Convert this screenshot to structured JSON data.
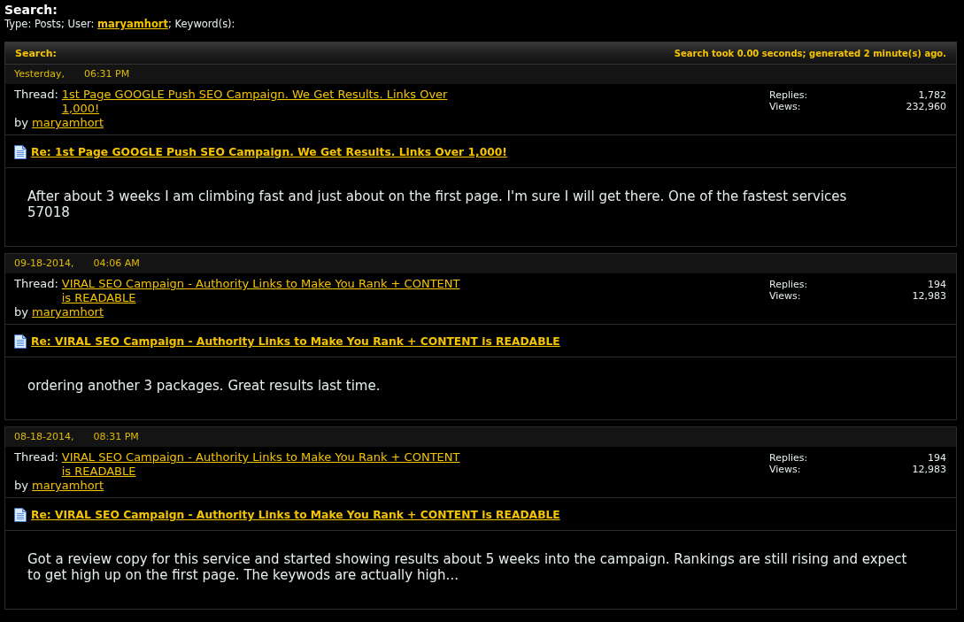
{
  "page_title": "Search:",
  "search_criteria": {
    "before_user": "Type: Posts; User:",
    "user": "maryamhort",
    "after_user": "; Keyword(s):"
  },
  "results_header": {
    "title": "Search:",
    "stats": "Search took 0.00 seconds; generated 2 minute(s) ago."
  },
  "posts": [
    {
      "date": "Yesterday,",
      "time": "06:31 PM",
      "thread_label": "Thread:",
      "thread_title": "1st Page GOOGLE Push SEO Campaign. We Get Results. Links Over 1,000!",
      "by_label": "by",
      "author": "maryamhort",
      "replies_label": "Replies:",
      "replies": "1,782",
      "views_label": "Views:",
      "views": "232,960",
      "post_title": "Re: 1st Page GOOGLE Push SEO Campaign. We Get Results. Links Over 1,000!",
      "excerpt": "After about 3 weeks I am climbing fast and just about on the first page. I'm sure I will get there. One of the fastest services\n57018"
    },
    {
      "date": "09-18-2014,",
      "time": "04:06 AM",
      "thread_label": "Thread:",
      "thread_title": "VIRAL SEO Campaign - Authority Links to Make You Rank + CONTENT is READABLE",
      "by_label": "by",
      "author": "maryamhort",
      "replies_label": "Replies:",
      "replies": "194",
      "views_label": "Views:",
      "views": "12,983",
      "post_title": "Re: VIRAL SEO Campaign - Authority Links to Make You Rank + CONTENT is READABLE",
      "excerpt": "ordering another 3 packages. Great results last time."
    },
    {
      "date": "08-18-2014,",
      "time": "08:31 PM",
      "thread_label": "Thread:",
      "thread_title": "VIRAL SEO Campaign - Authority Links to Make You Rank + CONTENT is READABLE",
      "by_label": "by",
      "author": "maryamhort",
      "replies_label": "Replies:",
      "replies": "194",
      "views_label": "Views:",
      "views": "12,983",
      "post_title": "Re: VIRAL SEO Campaign - Authority Links to Make You Rank + CONTENT is READABLE",
      "excerpt": "Got a review copy for this service and started showing results about 5 weeks into the campaign. Rankings are still rising and expect to get high up on the first page. The keywods are actually high..."
    }
  ]
}
